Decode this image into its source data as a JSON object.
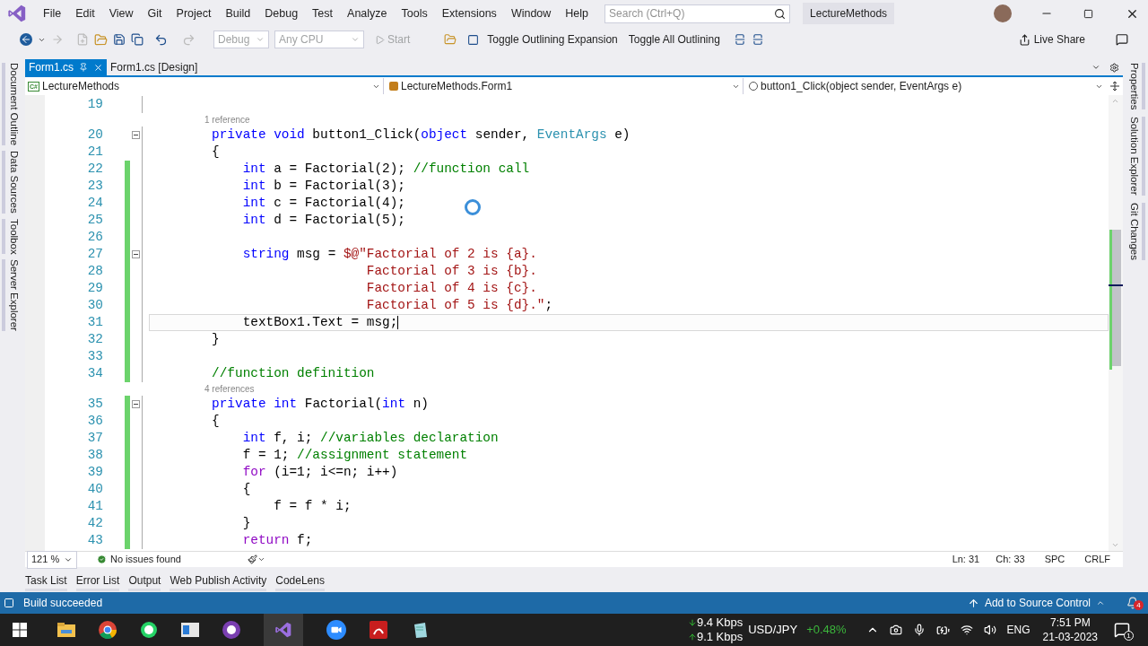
{
  "menu": [
    "File",
    "Edit",
    "View",
    "Git",
    "Project",
    "Build",
    "Debug",
    "Test",
    "Analyze",
    "Tools",
    "Extensions",
    "Window",
    "Help"
  ],
  "search": {
    "placeholder": "Search (Ctrl+Q)"
  },
  "solution_name": "LectureMethods",
  "toolbar": {
    "configuration": "Debug",
    "platform": "Any CPU",
    "start": "Start",
    "buttons": [
      "Toggle Outlining Expansion",
      "Toggle All Outlining"
    ],
    "live_share": "Live Share"
  },
  "left_panels": [
    "Document Outline",
    "Data Sources",
    "Toolbox",
    "Server Explorer"
  ],
  "right_panels": [
    "Properties",
    "Solution Explorer",
    "Git Changes"
  ],
  "doc_tabs": [
    {
      "label": "Form1.cs",
      "selected": true
    },
    {
      "label": "Form1.cs [Design]",
      "selected": false
    }
  ],
  "nav": {
    "language_badge": "C#",
    "project": "LectureMethods",
    "class": "LectureMethods.Form1",
    "member": "button1_Click(object sender, EventArgs e)"
  },
  "code": [
    {
      "kind": "line",
      "number": "19",
      "modified": false,
      "fold": false,
      "current": false
    },
    {
      "kind": "lens",
      "text": "1 reference"
    },
    {
      "kind": "line",
      "number": "20",
      "modified": false,
      "fold": true,
      "current": false,
      "tokens": [
        {
          "kind": "kw",
          "text": "        private "
        },
        {
          "kind": "kw",
          "text": "void"
        },
        {
          "kind": "txt",
          "text": " button1_Click("
        },
        {
          "kind": "kw",
          "text": "object"
        },
        {
          "kind": "txt",
          "text": " sender, "
        },
        {
          "kind": "type",
          "text": "EventArgs"
        },
        {
          "kind": "txt",
          "text": " e)"
        }
      ]
    },
    {
      "kind": "line",
      "number": "21",
      "modified": false,
      "fold": false,
      "current": false,
      "tokens": [
        {
          "kind": "txt",
          "text": "        {"
        }
      ]
    },
    {
      "kind": "line",
      "number": "22",
      "modified": true,
      "fold": false,
      "current": false,
      "tokens": [
        {
          "kind": "kw",
          "text": "            int"
        },
        {
          "kind": "txt",
          "text": " a = Factorial(2); "
        },
        {
          "kind": "cm",
          "text": "//function call"
        }
      ]
    },
    {
      "kind": "line",
      "number": "23",
      "modified": true,
      "fold": false,
      "current": false,
      "tokens": [
        {
          "kind": "kw",
          "text": "            int"
        },
        {
          "kind": "txt",
          "text": " b = Factorial(3);"
        }
      ]
    },
    {
      "kind": "line",
      "number": "24",
      "modified": true,
      "fold": false,
      "current": false,
      "tokens": [
        {
          "kind": "kw",
          "text": "            int"
        },
        {
          "kind": "txt",
          "text": " c = Factorial(4);"
        }
      ]
    },
    {
      "kind": "line",
      "number": "25",
      "modified": true,
      "fold": false,
      "current": false,
      "tokens": [
        {
          "kind": "kw",
          "text": "            int"
        },
        {
          "kind": "txt",
          "text": " d = Factorial(5);"
        }
      ]
    },
    {
      "kind": "line",
      "number": "26",
      "modified": true,
      "fold": false,
      "current": false
    },
    {
      "kind": "line",
      "number": "27",
      "modified": true,
      "fold": true,
      "current": false,
      "tokens": [
        {
          "kind": "kw",
          "text": "            string"
        },
        {
          "kind": "txt",
          "text": " msg = "
        },
        {
          "kind": "str",
          "text": "$@\"Factorial of 2 is {a}."
        }
      ]
    },
    {
      "kind": "line",
      "number": "28",
      "modified": true,
      "fold": false,
      "current": false,
      "tokens": [
        {
          "kind": "str",
          "text": "                            Factorial of 3 is {b}."
        }
      ]
    },
    {
      "kind": "line",
      "number": "29",
      "modified": true,
      "fold": false,
      "current": false,
      "tokens": [
        {
          "kind": "str",
          "text": "                            Factorial of 4 is {c}."
        }
      ]
    },
    {
      "kind": "line",
      "number": "30",
      "modified": true,
      "fold": false,
      "current": false,
      "tokens": [
        {
          "kind": "str",
          "text": "                            Factorial of 5 is {d}.\""
        },
        {
          "kind": "txt",
          "text": ";"
        }
      ]
    },
    {
      "kind": "line",
      "number": "31",
      "modified": true,
      "fold": false,
      "current": true,
      "tokens": [
        {
          "kind": "txt",
          "text": "            textBox1.Text = msg;"
        }
      ]
    },
    {
      "kind": "line",
      "number": "32",
      "modified": true,
      "fold": false,
      "current": false,
      "tokens": [
        {
          "kind": "txt",
          "text": "        }"
        }
      ]
    },
    {
      "kind": "line",
      "number": "33",
      "modified": true,
      "fold": false,
      "current": false
    },
    {
      "kind": "line",
      "number": "34",
      "modified": true,
      "fold": false,
      "current": false,
      "tokens": [
        {
          "kind": "cm",
          "text": "        //function definition"
        }
      ]
    },
    {
      "kind": "lens",
      "text": "4 references"
    },
    {
      "kind": "line",
      "number": "35",
      "modified": true,
      "fold": true,
      "current": false,
      "tokens": [
        {
          "kind": "kw",
          "text": "        private "
        },
        {
          "kind": "kw",
          "text": "int"
        },
        {
          "kind": "txt",
          "text": " Factorial("
        },
        {
          "kind": "kw",
          "text": "int"
        },
        {
          "kind": "txt",
          "text": " n)"
        }
      ]
    },
    {
      "kind": "line",
      "number": "36",
      "modified": true,
      "fold": false,
      "current": false,
      "tokens": [
        {
          "kind": "txt",
          "text": "        {"
        }
      ]
    },
    {
      "kind": "line",
      "number": "37",
      "modified": true,
      "fold": false,
      "current": false,
      "tokens": [
        {
          "kind": "kw",
          "text": "            int"
        },
        {
          "kind": "txt",
          "text": " f, i; "
        },
        {
          "kind": "cm",
          "text": "//variables declaration"
        }
      ]
    },
    {
      "kind": "line",
      "number": "38",
      "modified": true,
      "fold": false,
      "current": false,
      "tokens": [
        {
          "kind": "txt",
          "text": "            f = 1; "
        },
        {
          "kind": "cm",
          "text": "//assignment statement"
        }
      ]
    },
    {
      "kind": "line",
      "number": "39",
      "modified": true,
      "fold": false,
      "current": false,
      "tokens": [
        {
          "kind": "ctl",
          "text": "            for"
        },
        {
          "kind": "txt",
          "text": " (i=1; i<=n; i++)"
        }
      ]
    },
    {
      "kind": "line",
      "number": "40",
      "modified": true,
      "fold": false,
      "current": false,
      "tokens": [
        {
          "kind": "txt",
          "text": "            {"
        }
      ]
    },
    {
      "kind": "line",
      "number": "41",
      "modified": true,
      "fold": false,
      "current": false,
      "tokens": [
        {
          "kind": "txt",
          "text": "                f = f * i;"
        }
      ]
    },
    {
      "kind": "line",
      "number": "42",
      "modified": true,
      "fold": false,
      "current": false,
      "tokens": [
        {
          "kind": "txt",
          "text": "            }"
        }
      ]
    },
    {
      "kind": "line",
      "number": "43",
      "modified": true,
      "fold": false,
      "current": false,
      "tokens": [
        {
          "kind": "ctl",
          "text": "            return"
        },
        {
          "kind": "txt",
          "text": " f;"
        }
      ]
    }
  ],
  "editor_status": {
    "zoom": "121 %",
    "issues": "No issues found",
    "line": "Ln: 31",
    "col": "Ch: 33",
    "spaces": "SPC",
    "eol": "CRLF"
  },
  "tool_tabs": [
    "Task List",
    "Error List",
    "Output",
    "Web Publish Activity",
    "CodeLens"
  ],
  "status_bar": {
    "message": "Build succeeded",
    "source_control": "Add to Source Control",
    "notifications": "4"
  },
  "taskbar": {
    "net_down": "9.4 Kbps",
    "net_up": "9.1 Kbps",
    "ticker": "USD/JPY",
    "change": "+0.48%",
    "lang": "ENG",
    "time": "7:51 PM",
    "date": "21-03-2023",
    "notification_count": "1"
  }
}
